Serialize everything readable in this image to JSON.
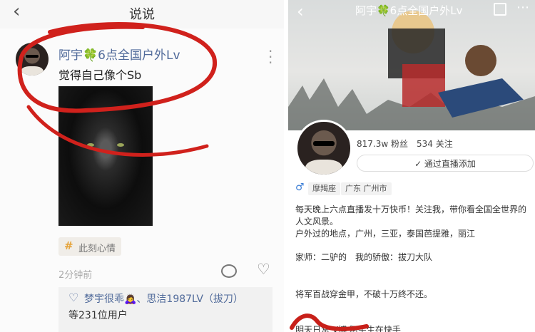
{
  "left": {
    "nav_title": "说说",
    "author": "阿宇🍀6点全国户外Lv",
    "post_text": "觉得自己像个Sb",
    "topic_tag": "此刻心情",
    "time": "2分钟前",
    "likers": "梦宇很乖🙇‍♀️、思洁1987LV（拔刀）",
    "like_count": "等231位用户"
  },
  "right": {
    "title": "阿宇🍀6点全国户外Lv",
    "fans": "817.3w 粉丝",
    "follows": "534 关注",
    "follow_btn": "✓ 通过直播添加",
    "tag_zodiac": "摩羯座",
    "tag_location": "广东 广州市",
    "bio_line1": "每天晚上六点直播发十万快币！关注我，带你看全国全世界的",
    "bio_line2": "人文风景。",
    "bio_line3": "户外过的地点，广州，三亚，泰国芭提雅，丽江",
    "bio_line4": "家师：二驴的　我的骄傲：拔刀大队",
    "bio_line5": "将军百战穿金甲，不破十万终不还。",
    "bio_line6": "明天日常 V博 阿宇生在快手"
  },
  "colors": {
    "link": "#506a9a",
    "annotation": "#d0211c"
  }
}
